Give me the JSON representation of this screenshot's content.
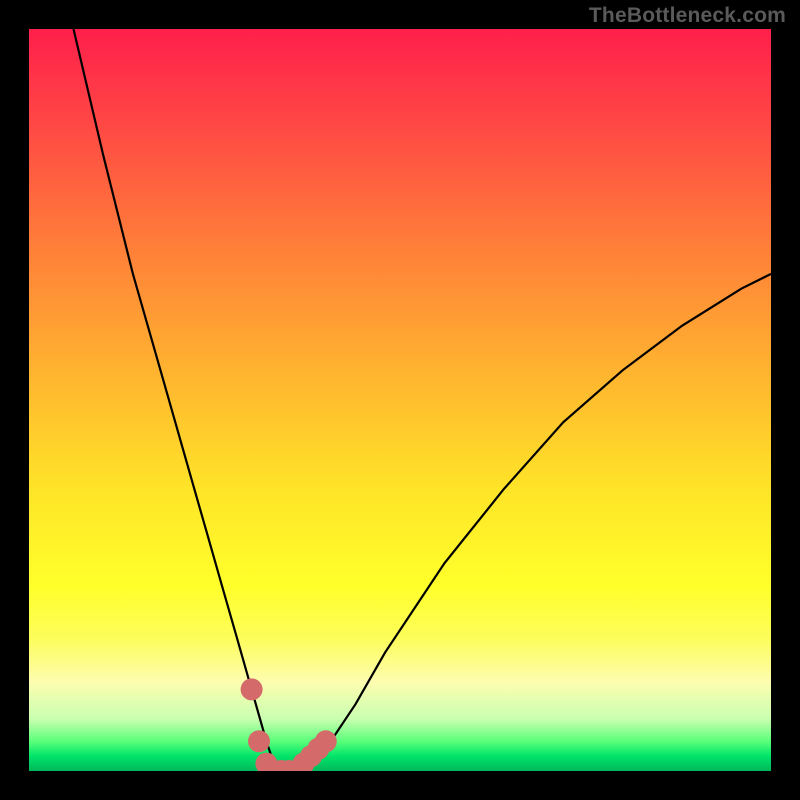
{
  "watermark": "TheBottleneck.com",
  "chart_data": {
    "type": "line",
    "title": "",
    "xlabel": "",
    "ylabel": "",
    "xlim": [
      0,
      100
    ],
    "ylim": [
      0,
      100
    ],
    "series": [
      {
        "name": "bottleneck-curve",
        "x": [
          6,
          10,
          14,
          18,
          22,
          24,
          26,
          28,
          30,
          32,
          33,
          34,
          35,
          36,
          38,
          40,
          44,
          48,
          56,
          64,
          72,
          80,
          88,
          96,
          100
        ],
        "values": [
          100,
          83,
          67,
          53,
          39,
          32,
          25,
          18,
          11,
          4,
          1,
          0,
          0,
          0,
          1,
          3,
          9,
          16,
          28,
          38,
          47,
          54,
          60,
          65,
          67
        ]
      }
    ],
    "markers": {
      "name": "highlight-dots",
      "color": "#d46a6a",
      "points": [
        {
          "x": 30.0,
          "y": 11
        },
        {
          "x": 31.0,
          "y": 4
        },
        {
          "x": 32.0,
          "y": 1
        },
        {
          "x": 33.0,
          "y": 0
        },
        {
          "x": 34.0,
          "y": 0
        },
        {
          "x": 35.0,
          "y": 0
        },
        {
          "x": 36.0,
          "y": 0
        },
        {
          "x": 37.0,
          "y": 1
        },
        {
          "x": 38.0,
          "y": 2
        },
        {
          "x": 39.0,
          "y": 3
        },
        {
          "x": 40.0,
          "y": 4
        }
      ]
    }
  }
}
